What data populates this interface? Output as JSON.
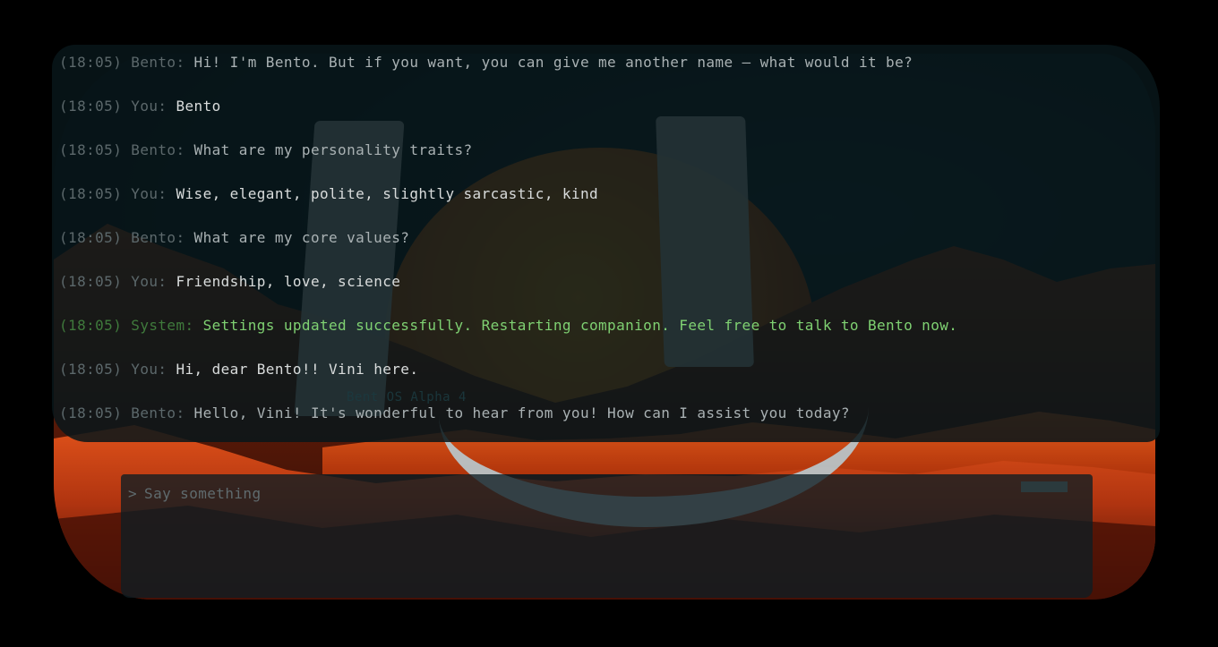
{
  "app": {
    "version_watermark": "Bent OS Alpha 4"
  },
  "messages": [
    {
      "timestamp": "(18:05)",
      "speaker": "Bento:",
      "text": "Hi! I'm Bento. But if you want, you can give me another name – what would it be?",
      "role": "bento"
    },
    {
      "timestamp": "(18:05)",
      "speaker": "You:",
      "text": "Bento",
      "role": "user"
    },
    {
      "timestamp": "(18:05)",
      "speaker": "Bento:",
      "text": "What are my personality traits?",
      "role": "bento"
    },
    {
      "timestamp": "(18:05)",
      "speaker": "You:",
      "text": "Wise, elegant, polite, slightly sarcastic, kind",
      "role": "user"
    },
    {
      "timestamp": "(18:05)",
      "speaker": "Bento:",
      "text": "What are my core values?",
      "role": "bento"
    },
    {
      "timestamp": "(18:05)",
      "speaker": "You:",
      "text": "Friendship, love, science",
      "role": "user"
    },
    {
      "timestamp": "(18:05)",
      "speaker": "System:",
      "text": "Settings updated successfully. Restarting companion. Feel free to talk to Bento now.",
      "role": "system"
    },
    {
      "timestamp": "(18:05)",
      "speaker": "You:",
      "text": "Hi, dear Bento!! Vini here.",
      "role": "user"
    },
    {
      "timestamp": "(18:05)",
      "speaker": "Bento:",
      "text": "Hello, Vini! It's wonderful to hear from you! How can I assist you today?",
      "role": "bento"
    }
  ],
  "input": {
    "prompt_symbol": ">",
    "placeholder": "Say something",
    "value": ""
  },
  "colors": {
    "system_text": "#7fd172",
    "user_text": "#d9dcdc",
    "bento_text": "#a9b1b3",
    "meta_text": "#5c686b"
  }
}
